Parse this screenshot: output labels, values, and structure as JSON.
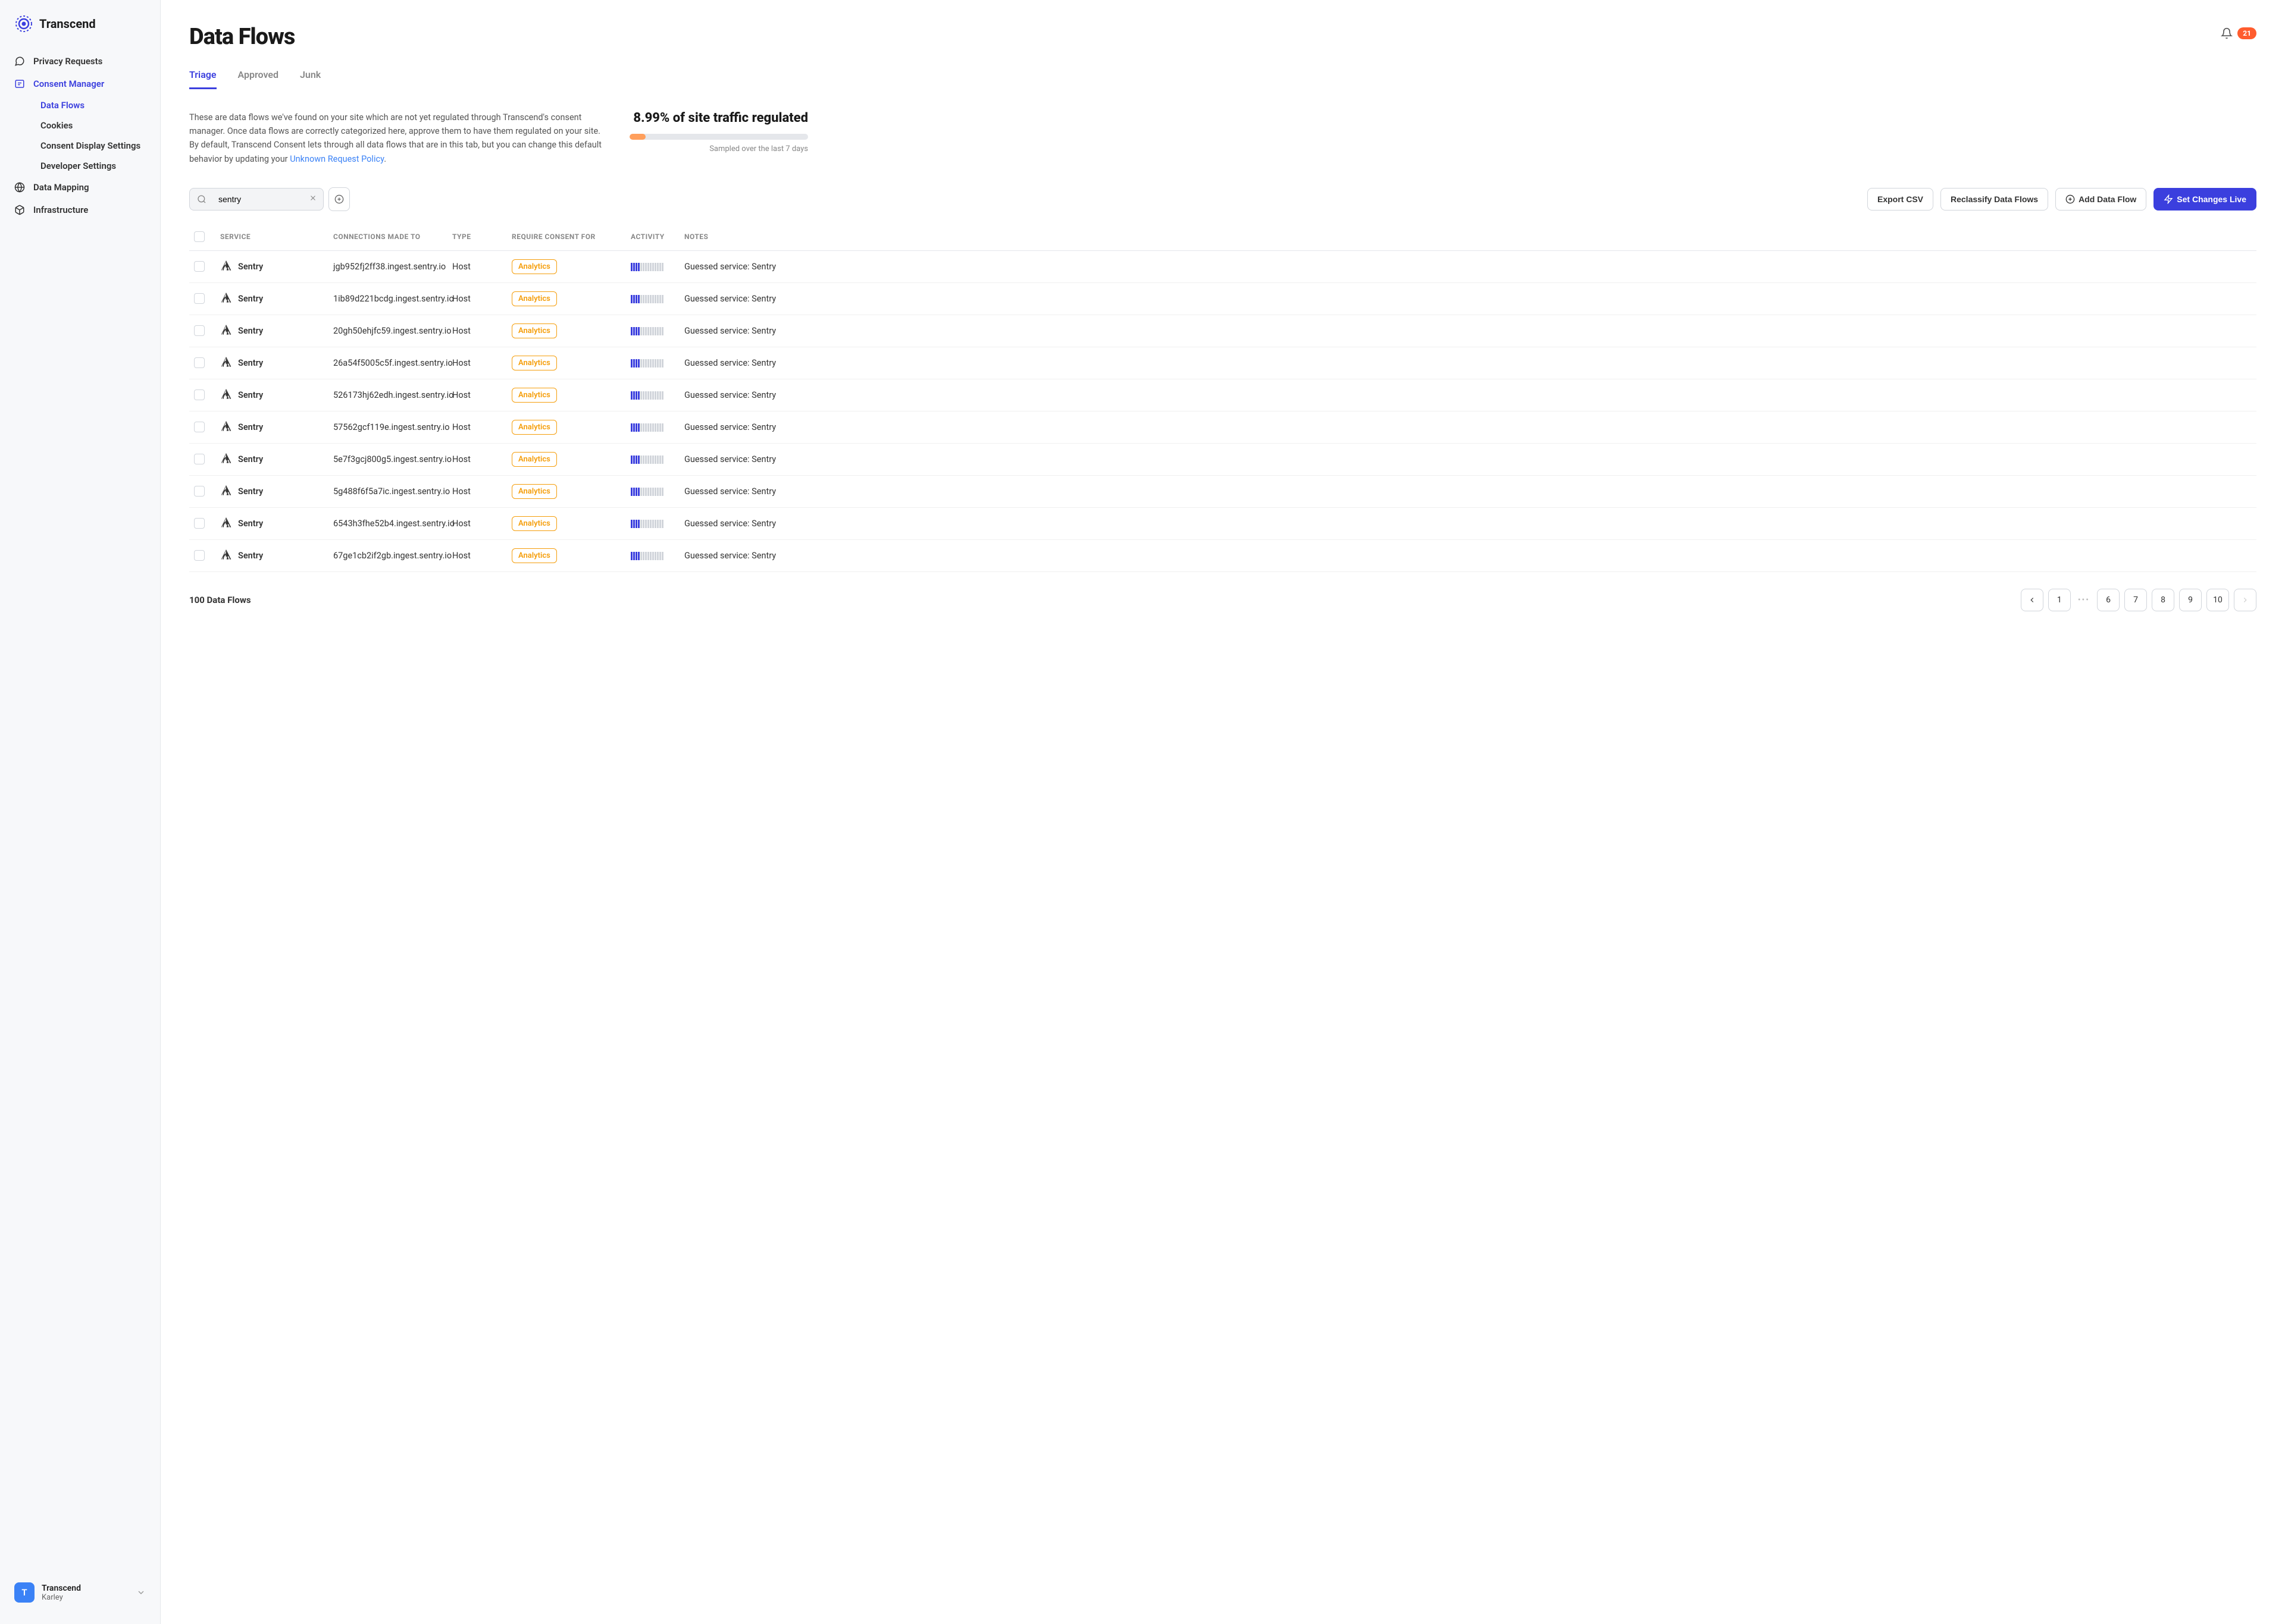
{
  "brand": "Transcend",
  "notification_count": "21",
  "sidebar": {
    "items": [
      {
        "label": "Privacy Requests",
        "icon": "privacy"
      },
      {
        "label": "Consent Manager",
        "icon": "consent",
        "active": true,
        "children": [
          {
            "label": "Data Flows",
            "active": true
          },
          {
            "label": "Cookies"
          },
          {
            "label": "Consent Display Settings"
          },
          {
            "label": "Developer Settings"
          }
        ]
      },
      {
        "label": "Data Mapping",
        "icon": "mapping"
      },
      {
        "label": "Infrastructure",
        "icon": "infra"
      }
    ],
    "user": {
      "avatar": "T",
      "org": "Transcend",
      "name": "Karley"
    }
  },
  "page_title": "Data Flows",
  "tabs": [
    {
      "label": "Triage",
      "active": true
    },
    {
      "label": "Approved"
    },
    {
      "label": "Junk"
    }
  ],
  "description_a": "These are data flows we've found on your site which are not yet regulated through Transcend's consent manager. Once data flows are correctly categorized here, approve them to have them regulated on your site. By default, Transcend Consent lets through all data flows that are in this tab, but you can change this default behavior by updating your ",
  "description_link": "Unknown Request Policy",
  "description_b": ".",
  "stats": {
    "headline": "8.99% of site traffic regulated",
    "percent": 8.99,
    "subtitle": "Sampled over the last 7 days"
  },
  "search": {
    "value": "sentry"
  },
  "actions": {
    "export": "Export CSV",
    "reclassify": "Reclassify Data Flows",
    "add": "Add Data Flow",
    "set_live": "Set Changes Live"
  },
  "columns": {
    "service": "Service",
    "connections": "Connections Made To",
    "type": "Type",
    "consent": "Require Consent For",
    "activity": "Activity",
    "notes": "Notes"
  },
  "rows": [
    {
      "service": "Sentry",
      "connection": "jgb952fj2ff38.ingest.sentry.io",
      "type": "Host",
      "consent": "Analytics",
      "notes": "Guessed service: Sentry"
    },
    {
      "service": "Sentry",
      "connection": "1ib89d221bcdg.ingest.sentry.io",
      "type": "Host",
      "consent": "Analytics",
      "notes": "Guessed service: Sentry"
    },
    {
      "service": "Sentry",
      "connection": "20gh50ehjfc59.ingest.sentry.io",
      "type": "Host",
      "consent": "Analytics",
      "notes": "Guessed service: Sentry"
    },
    {
      "service": "Sentry",
      "connection": "26a54f5005c5f.ingest.sentry.io",
      "type": "Host",
      "consent": "Analytics",
      "notes": "Guessed service: Sentry"
    },
    {
      "service": "Sentry",
      "connection": "526173hj62edh.ingest.sentry.io",
      "type": "Host",
      "consent": "Analytics",
      "notes": "Guessed service: Sentry"
    },
    {
      "service": "Sentry",
      "connection": "57562gcf119e.ingest.sentry.io",
      "type": "Host",
      "consent": "Analytics",
      "notes": "Guessed service: Sentry"
    },
    {
      "service": "Sentry",
      "connection": "5e7f3gcj800g5.ingest.sentry.io",
      "type": "Host",
      "consent": "Analytics",
      "notes": "Guessed service: Sentry"
    },
    {
      "service": "Sentry",
      "connection": "5g488f6f5a7ic.ingest.sentry.io",
      "type": "Host",
      "consent": "Analytics",
      "notes": "Guessed service: Sentry"
    },
    {
      "service": "Sentry",
      "connection": "6543h3fhe52b4.ingest.sentry.io",
      "type": "Host",
      "consent": "Analytics",
      "notes": "Guessed service: Sentry"
    },
    {
      "service": "Sentry",
      "connection": "67ge1cb2if2gb.ingest.sentry.io",
      "type": "Host",
      "consent": "Analytics",
      "notes": "Guessed service: Sentry"
    }
  ],
  "footer": {
    "count": "100 Data Flows"
  },
  "pagination": {
    "pages": [
      "1",
      "6",
      "7",
      "8",
      "9",
      "10"
    ]
  }
}
